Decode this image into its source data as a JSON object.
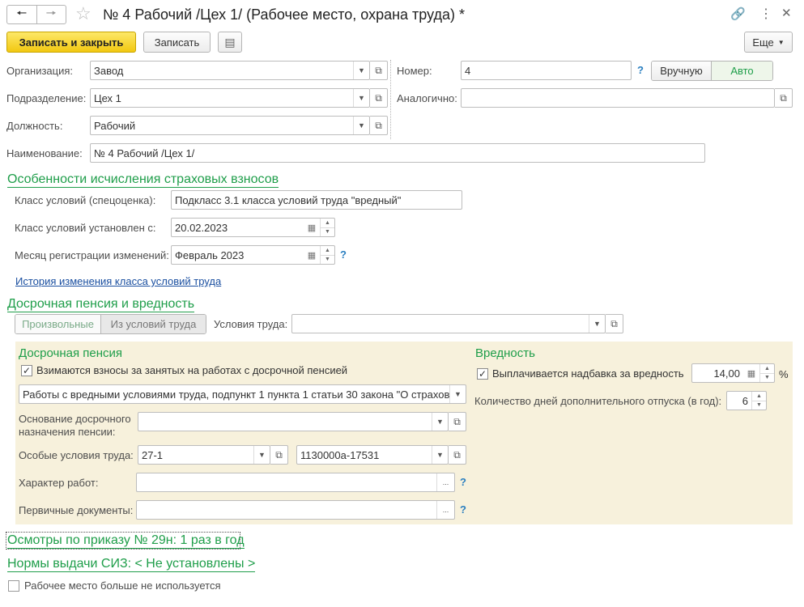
{
  "titlebar": {
    "title": "№ 4 Рабочий /Цех 1/ (Рабочее место, охрана труда) *",
    "back_icon": "arrow-left-icon",
    "forward_icon": "arrow-right-icon",
    "star_icon": "star-icon",
    "link_icon": "link-icon",
    "more_icon": "more-vertical-icon",
    "close_icon": "close-icon"
  },
  "toolbar": {
    "save_close": "Записать и закрыть",
    "save": "Записать",
    "more": "Еще"
  },
  "header": {
    "organization_label": "Организация:",
    "organization_value": "Завод",
    "subdivision_label": "Подразделение:",
    "subdivision_value": "Цех 1",
    "position_label": "Должность:",
    "position_value": "Рабочий",
    "number_label": "Номер:",
    "number_value": "4",
    "manual_btn": "Вручную",
    "auto_btn": "Авто",
    "analog_label": "Аналогично:",
    "analog_value": "",
    "name_label": "Наименование:",
    "name_value": "№ 4 Рабочий /Цех 1/",
    "help": "?"
  },
  "insurance": {
    "title": "Особенности исчисления страховых взносов",
    "class_label": "Класс условий (спецоценка):",
    "class_value": "Подкласс 3.1 класса условий труда \"вредный\"",
    "class_since_label": "Класс условий установлен с:",
    "class_since_value": "20.02.2023",
    "month_label": "Месяц регистрации изменений:",
    "month_value": "Февраль 2023",
    "history_link": "История изменения класса условий труда"
  },
  "pension": {
    "title": "Досрочная пенсия и вредность",
    "tab_arbitrary": "Произвольные",
    "tab_from_conditions": "Из условий труда",
    "conditions_label": "Условия труда:",
    "conditions_value": "",
    "early_title": "Досрочная пенсия",
    "early_check_label": "Взимаются взносы за занятых на работах с досрочной пенсией",
    "early_check_mark": "✓",
    "works_value": "Работы с вредными условиями труда, подпункт 1 пункта 1 статьи 30 закона \"О страхов",
    "basis_label_1": "Основание досрочного",
    "basis_label_2": "назначения пенсии:",
    "basis_value": "",
    "special_label": "Особые условия труда:",
    "special_value_1": "27-1",
    "special_value_2": "1130000а-17531",
    "work_char_label": "Характер работ:",
    "work_char_value": "",
    "primary_docs_label": "Первичные документы:",
    "primary_docs_value": "",
    "harm_title": "Вредность",
    "harm_check_label": "Выплачивается надбавка за вредность",
    "harm_check_mark": "✓",
    "harm_value": "14,00",
    "percent": "%",
    "extra_days_label": "Количество дней дополнительного отпуска (в год):",
    "extra_days_value": "6"
  },
  "footer": {
    "exams_link": "Осмотры по приказу № 29н: 1 раз в год",
    "siz_link": "Нормы выдачи СИЗ: < Не установлены >",
    "not_used_label": "Рабочее место больше не используется"
  }
}
